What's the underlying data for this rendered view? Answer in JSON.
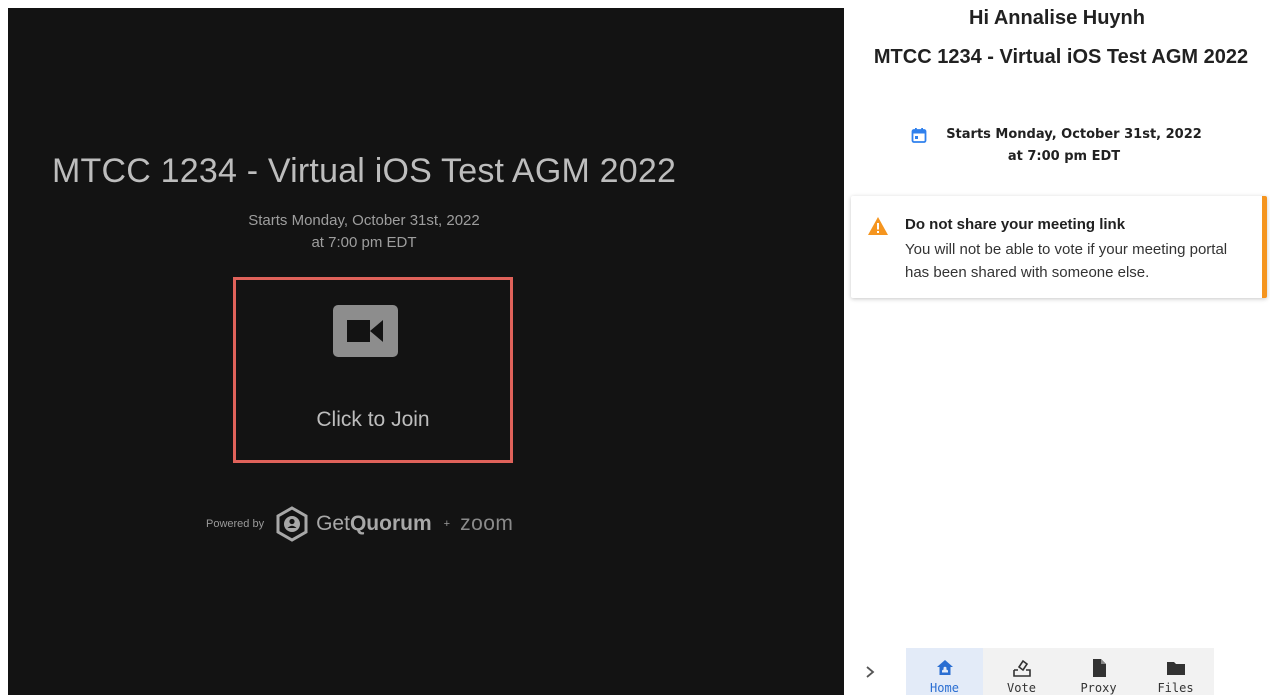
{
  "video": {
    "title": "MTCC 1234 - Virtual iOS Test AGM 2022",
    "starts_line1": "Starts Monday, October 31st, 2022",
    "starts_line2": "at 7:00 pm EDT",
    "join_label": "Click to Join",
    "powered_by": "Powered by",
    "brand_get": "Get",
    "brand_quorum": "Quorum",
    "plus": "+",
    "zoom": "zoom"
  },
  "panel": {
    "greeting": "Hi Annalise Huynh",
    "title": "MTCC 1234 - Virtual iOS Test AGM 2022",
    "starts_line1": "Starts Monday, October 31st, 2022",
    "starts_line2": "at 7:00 pm EDT",
    "alert": {
      "title": "Do not share your meeting link",
      "body": "You will not be able to vote if your meeting portal has been shared with someone else."
    }
  },
  "nav": {
    "items": [
      {
        "label": "Home",
        "icon": "home-icon",
        "active": true
      },
      {
        "label": "Vote",
        "icon": "vote-icon"
      },
      {
        "label": "Proxy",
        "icon": "proxy-file-icon"
      },
      {
        "label": "Files",
        "icon": "folder-icon"
      }
    ]
  },
  "colors": {
    "video_bg": "#131313",
    "join_border": "#e0625a",
    "accent_blue": "#2a6ed2",
    "warning_orange": "#f5951f"
  }
}
